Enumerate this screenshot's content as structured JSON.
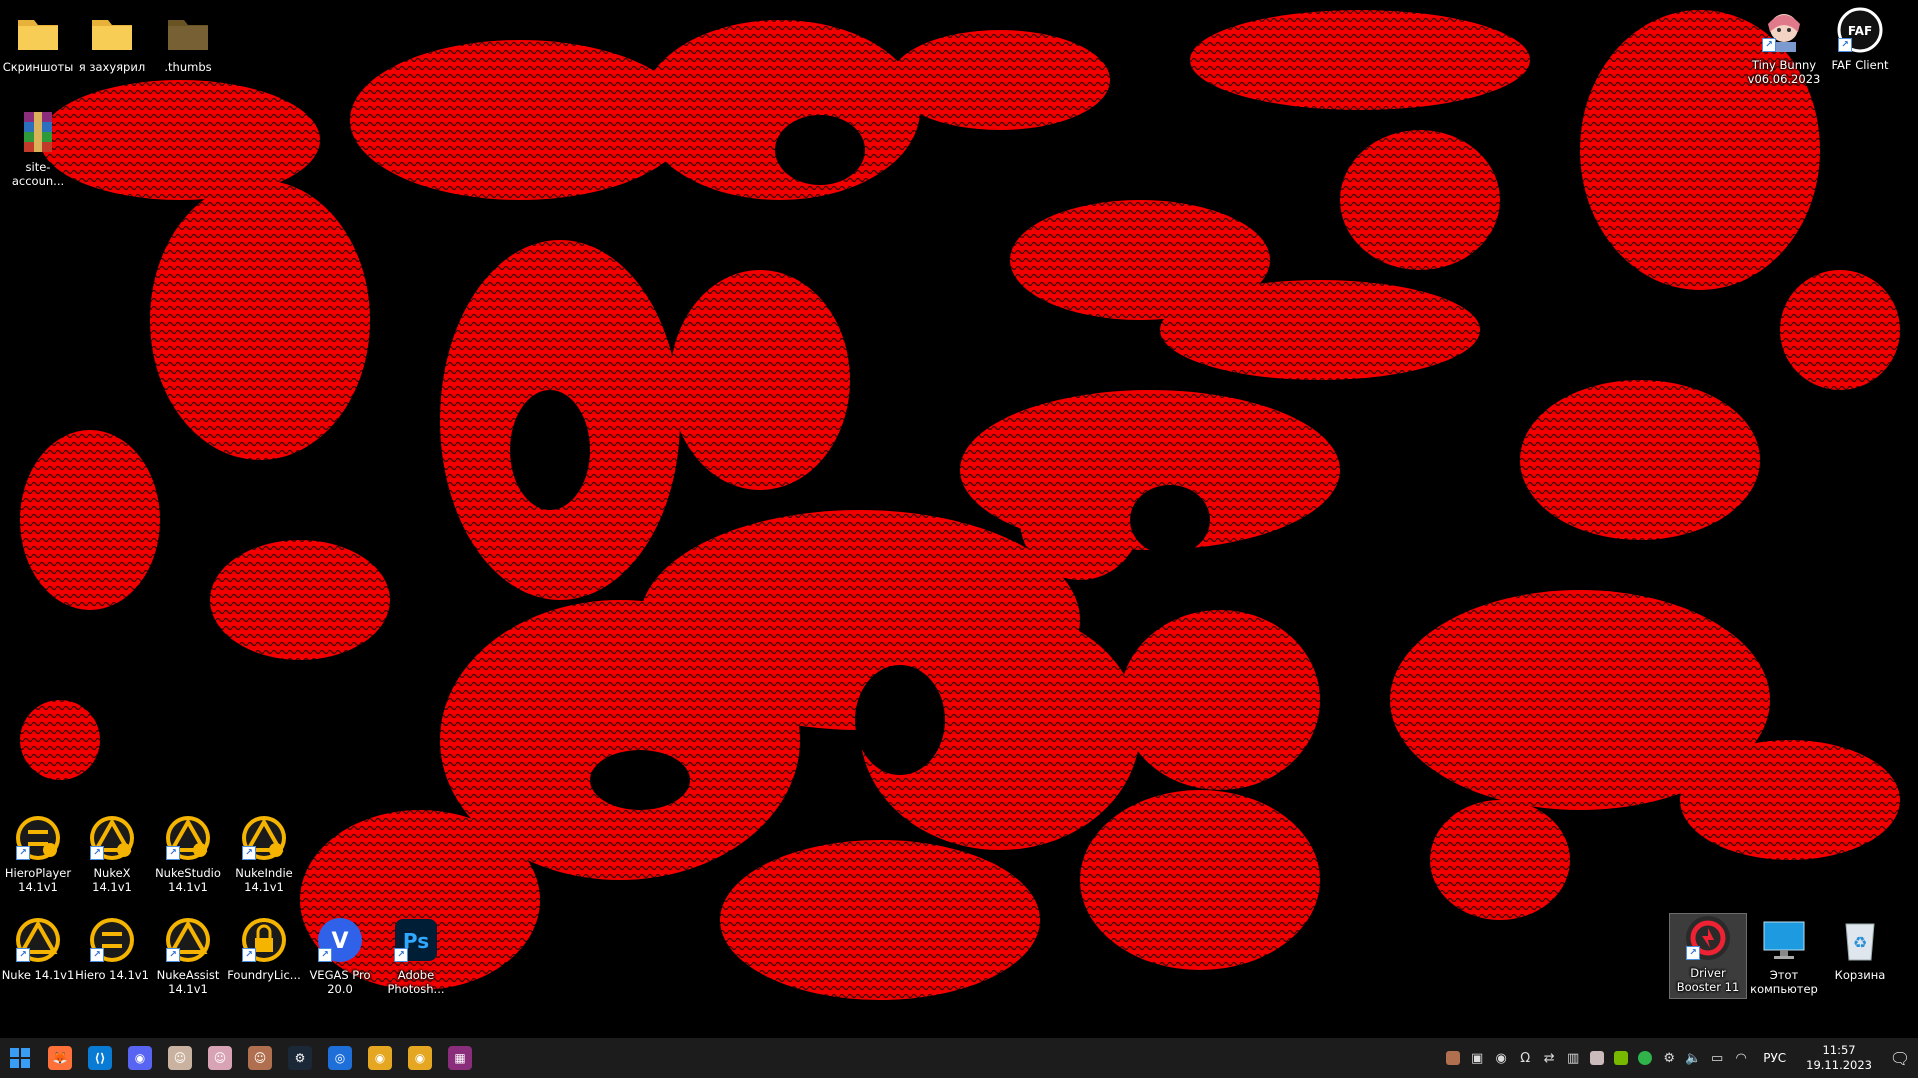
{
  "desktop": {
    "icons": {
      "screenshots": "Скриншоты",
      "zahuyaril": "я захуярил",
      "thumbs": ".thumbs",
      "site_accounts": "site-accoun...",
      "tiny_bunny": "Tiny Bunny\nv06.06.2023",
      "faf_client": "FAF Client",
      "hieroplayer": "HieroPlayer\n14.1v1",
      "nukex": "NukeX 14.1v1",
      "nukestudio": "NukeStudio\n14.1v1",
      "nukeindie": "NukeIndie\n14.1v1",
      "nuke": "Nuke 14.1v1",
      "hiero": "Hiero 14.1v1",
      "nukeassist": "NukeAssist\n14.1v1",
      "foundrylic": "FoundryLic...",
      "vegas": "VEGAS Pro\n20.0",
      "photoshop": "Adobe\nPhotosh...",
      "driver_booster": "Driver\nBooster 11",
      "this_pc": "Этот\nкомпьютер",
      "recycle_bin": "Корзина"
    },
    "icon_glyphs": {
      "vegas": "V",
      "photoshop": "Ps",
      "faf": "FAF"
    }
  },
  "taskbar": {
    "apps": [
      {
        "name": "firefox",
        "glyph": "🦊",
        "color": "#ff7139"
      },
      {
        "name": "vscode",
        "glyph": "⟨⟩",
        "color": "#0a7bd4"
      },
      {
        "name": "discord",
        "glyph": "◉",
        "color": "#5865f2"
      },
      {
        "name": "app-avatar-1",
        "glyph": "☺",
        "color": "#c9b3a0"
      },
      {
        "name": "app-avatar-2",
        "glyph": "☺",
        "color": "#d7a3b5"
      },
      {
        "name": "app-avatar-3",
        "glyph": "☺",
        "color": "#b07050"
      },
      {
        "name": "steam",
        "glyph": "⚙",
        "color": "#1b2838"
      },
      {
        "name": "capture",
        "glyph": "◎",
        "color": "#1e6fd9"
      },
      {
        "name": "chrome",
        "glyph": "◉",
        "color": "#e5a722"
      },
      {
        "name": "chrome-2",
        "glyph": "◉",
        "color": "#e5a722"
      },
      {
        "name": "winrar",
        "glyph": "▦",
        "color": "#8a2d7a"
      }
    ],
    "language": "РУС",
    "time": "11:57",
    "date": "19.11.2023"
  },
  "colors": {
    "wallpaper_red": "#ff0000",
    "taskbar_bg": "#1c1c1c"
  }
}
